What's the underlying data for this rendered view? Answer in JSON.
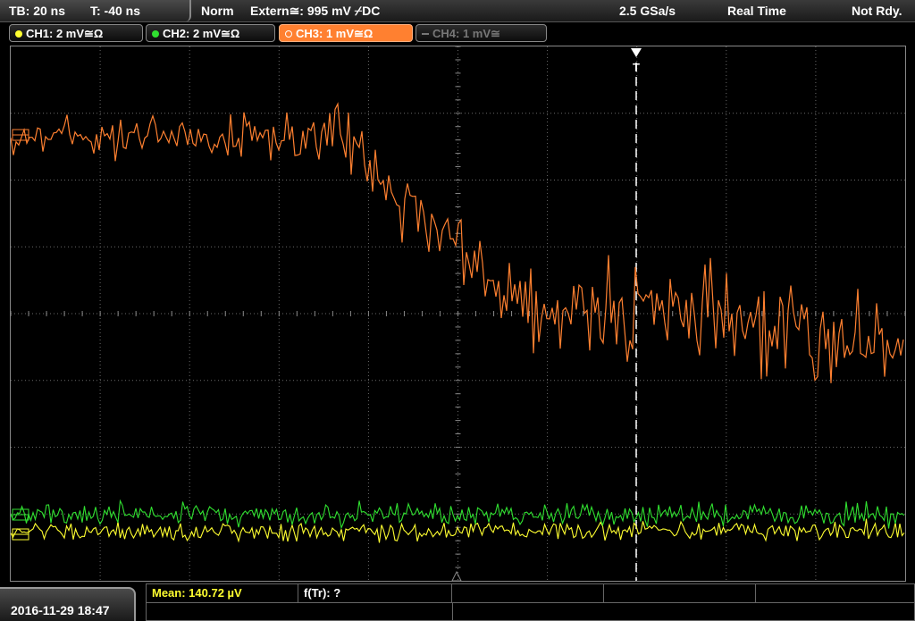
{
  "header": {
    "timebase": "TB: 20 ns",
    "trigger_time": "T: -40 ns",
    "mode": "Norm",
    "trigger_source": "Extern≅: 995 mV ⌿DC",
    "sample_rate": "2.5 GSa/s",
    "acquisition": "Real Time",
    "status": "Not Rdy."
  },
  "channels": [
    {
      "label": "CH1: 2 mV≅Ω",
      "color": "#ffff30",
      "active": false
    },
    {
      "label": "CH2: 2 mV≅Ω",
      "color": "#30e030",
      "active": false
    },
    {
      "label": "CH3: 1 mV≅Ω",
      "color": "#ff8030",
      "active": true
    },
    {
      "label": "CH4: 1 mV≅",
      "color": "#777777",
      "active": false
    }
  ],
  "plot": {
    "trigger_marker": "T",
    "h_divisions": 10,
    "v_divisions": 8
  },
  "footer": {
    "datetime": "2016-11-29 18:47",
    "measurements": {
      "mean": "Mean: 140.72 µV",
      "f_tr": "f(Tr): ?"
    }
  },
  "colors": {
    "ch1": "#ffff30",
    "ch2": "#30e030",
    "ch3": "#ff8030",
    "grid": "#6a6a6a"
  }
}
